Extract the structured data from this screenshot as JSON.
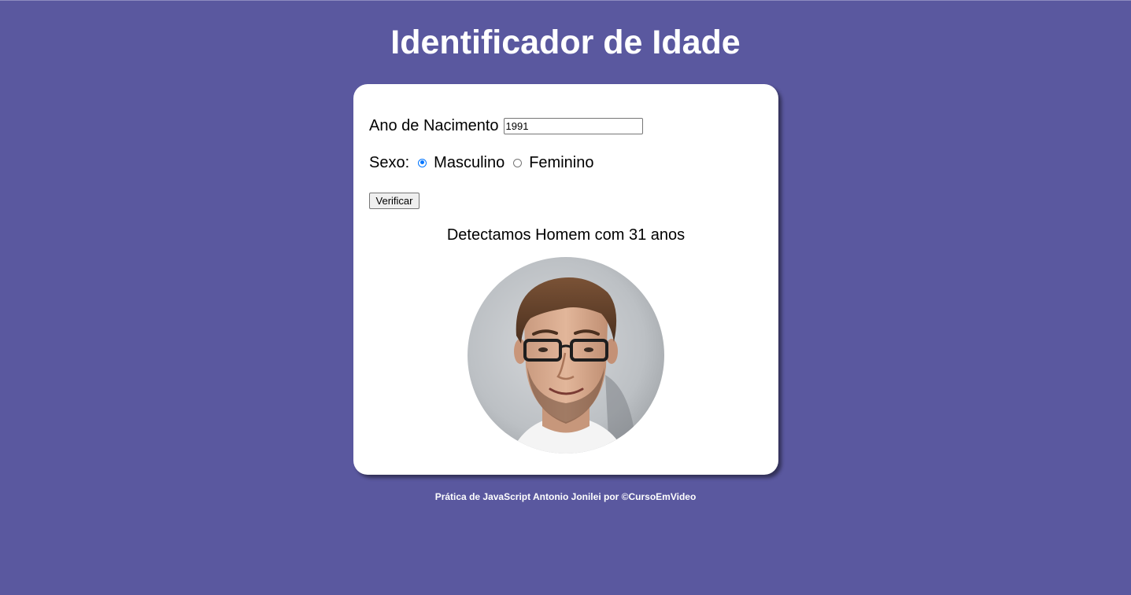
{
  "page": {
    "title": "Identificador de Idade",
    "background_color": "#5a589f"
  },
  "form": {
    "year_label": "Ano de Nacimento",
    "year_value": "1991",
    "sex_label": "Sexo:",
    "sex_options": [
      {
        "label": "Masculino",
        "checked": true
      },
      {
        "label": "Feminino",
        "checked": false
      }
    ],
    "verify_label": "Verificar"
  },
  "result": {
    "text": "Detectamos Homem com 31 anos",
    "image": "man-with-glasses-portrait"
  },
  "footer": {
    "text": "Prática de JavaScript Antonio Jonilei por ©CursoEmVideo"
  }
}
